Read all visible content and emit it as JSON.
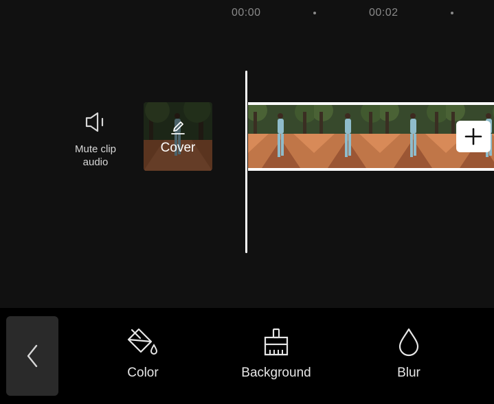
{
  "ruler": {
    "times": [
      "00:00",
      "00:02"
    ]
  },
  "clip_controls": {
    "mute_label": "Mute clip audio",
    "mute_icon": "speaker-mute-icon",
    "cover_label": "Cover",
    "cover_icon": "edit-pencil-icon"
  },
  "timeline": {
    "add_icon": "plus-icon"
  },
  "toolbar": {
    "back_icon": "chevron-left-icon",
    "tools": [
      {
        "label": "Color",
        "icon": "paint-bucket-icon"
      },
      {
        "label": "Background",
        "icon": "brush-icon"
      },
      {
        "label": "Blur",
        "icon": "droplet-icon"
      }
    ]
  },
  "colors": {
    "background": "#111111",
    "toolbar_background": "#000000",
    "accent": "#ffffff"
  }
}
